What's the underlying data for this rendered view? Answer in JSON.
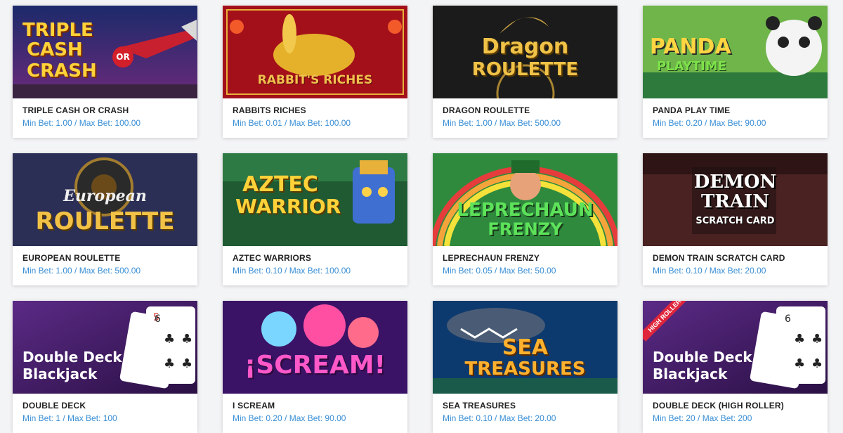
{
  "games": [
    {
      "title": "TRIPLE CASH OR CRASH",
      "bet": "Min Bet: 1.00 / Max Bet: 100.00",
      "art": [
        "TRIPLE",
        "CASH",
        "CRASH"
      ],
      "art_extra": "OR"
    },
    {
      "title": "RABBITS RICHES",
      "bet": "Min Bet: 0.01 / Max Bet: 100.00",
      "art": [
        "RABBIT'S RICHES"
      ]
    },
    {
      "title": "DRAGON ROULETTE",
      "bet": "Min Bet: 1.00 / Max Bet: 500.00",
      "art": [
        "Dragon",
        "ROULETTE"
      ]
    },
    {
      "title": "PANDA PLAY TIME",
      "bet": "Min Bet: 0.20 / Max Bet: 90.00",
      "art": [
        "PANDA",
        "PLAYTIME"
      ]
    },
    {
      "title": "EUROPEAN ROULETTE",
      "bet": "Min Bet: 1.00 / Max Bet: 500.00",
      "art": [
        "European",
        "ROULETTE"
      ]
    },
    {
      "title": "AZTEC WARRIORS",
      "bet": "Min Bet: 0.10 / Max Bet: 100.00",
      "art": [
        "AZTEC",
        "WARRIOR"
      ]
    },
    {
      "title": "LEPRECHAUN FRENZY",
      "bet": "Min Bet: 0.05 / Max Bet: 50.00",
      "art": [
        "LEPRECHAUN",
        "FRENZY"
      ]
    },
    {
      "title": "DEMON TRAIN SCRATCH CARD",
      "bet": "Min Bet: 0.10 / Max Bet: 20.00",
      "art": [
        "DEMON",
        "TRAIN",
        "SCRATCH CARD"
      ]
    },
    {
      "title": "DOUBLE DECK",
      "bet": "Min Bet: 1 / Max Bet: 100",
      "art": [
        "Double Deck",
        "Blackjack"
      ]
    },
    {
      "title": "I SCREAM",
      "bet": "Min Bet: 0.20 / Max Bet: 90.00",
      "art": [
        "¡SCREAM!"
      ]
    },
    {
      "title": "SEA TREASURES",
      "bet": "Min Bet: 0.10 / Max Bet: 20.00",
      "art": [
        "SEA",
        "TREASURES"
      ]
    },
    {
      "title": "DOUBLE DECK (HIGH ROLLER)",
      "bet": "Min Bet: 20 / Max Bet: 200",
      "art": [
        "Double Deck",
        "Blackjack"
      ],
      "badge": "HIGH ROLLER"
    }
  ],
  "colors": {
    "bet_text": "#3a8fd6",
    "title_text": "#222222",
    "card_bg": "#ffffff",
    "page_bg": "#f3f4f6"
  }
}
